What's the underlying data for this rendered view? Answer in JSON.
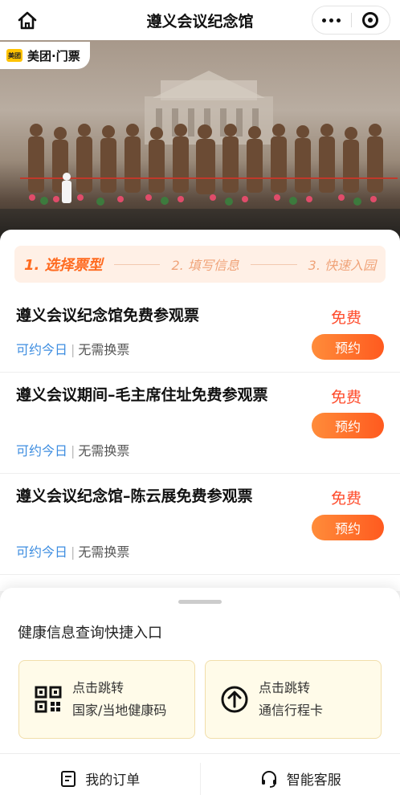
{
  "navbar": {
    "title": "遵义会议纪念馆"
  },
  "hero": {
    "brand_logo_text": "美团",
    "brand_text": "美团·门票"
  },
  "steps": [
    {
      "label": "1. 选择票型"
    },
    {
      "label": "2. 填写信息"
    },
    {
      "label": "3. 快速入园"
    }
  ],
  "tickets": [
    {
      "name": "遵义会议纪念馆免费参观票",
      "price": "免费",
      "button": "预约",
      "tag_available": "可约今日",
      "tag_sep": "|",
      "tag_exchange": "无需换票"
    },
    {
      "name": "遵义会议期间–毛主席住址免费参观票",
      "price": "免费",
      "button": "预约",
      "tag_available": "可约今日",
      "tag_sep": "|",
      "tag_exchange": "无需换票"
    },
    {
      "name": "遵义会议纪念馆–陈云展免费参观票",
      "price": "免费",
      "button": "预约",
      "tag_available": "可约今日",
      "tag_sep": "|",
      "tag_exchange": "无需换票"
    }
  ],
  "health": {
    "title": "健康信息查询快捷入口",
    "cards": [
      {
        "line1": "点击跳转",
        "line2": "国家/当地健康码",
        "icon": "qr-code-icon"
      },
      {
        "line1": "点击跳转",
        "line2": "通信行程卡",
        "icon": "arrow-up-circle-icon"
      }
    ]
  },
  "bottombar": {
    "orders_label": "我的订单",
    "service_label": "智能客服"
  },
  "colors": {
    "accent_orange": "#ff6a1f",
    "price_red": "#ff4b2b",
    "link_blue": "#3d8de0",
    "brand_yellow": "#ffc300"
  }
}
